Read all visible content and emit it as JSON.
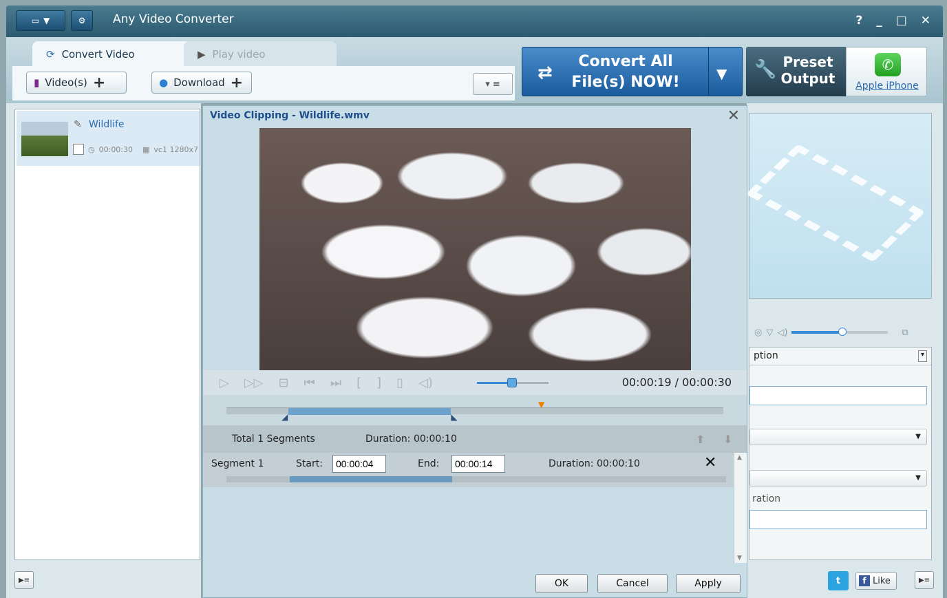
{
  "app": {
    "title": "Any Video Converter"
  },
  "window_controls": {
    "help": "?",
    "minimize": "_",
    "maximize": "□",
    "close": "✕"
  },
  "tabs": [
    {
      "label": "Convert Video",
      "active": true
    },
    {
      "label": "Play video",
      "active": false
    }
  ],
  "toolbar": {
    "videos_label": "Video(s)",
    "download_label": "Download",
    "convert_label": "Convert All File(s) NOW!",
    "preset_label": "Preset Output",
    "preset_device": "Apple iPhone"
  },
  "file_list": {
    "items": [
      {
        "name": "Wildlife",
        "duration": "00:00:30",
        "codec": "vc1 1280x7"
      }
    ]
  },
  "dialog": {
    "title": "Video Clipping - Wildlife.wmv",
    "time_display": "00:00:19 / 00:00:30",
    "progress_fraction": 0.633,
    "total_segments": "Total 1 Segments",
    "total_duration": "Duration: 00:00:10",
    "segment": {
      "name": "Segment 1",
      "start_label": "Start:",
      "start_value": "00:00:04",
      "end_label": "End:",
      "end_value": "00:00:14",
      "duration": "Duration: 00:00:10",
      "start_fraction": 0.133,
      "end_fraction": 0.467
    },
    "buttons": {
      "ok": "OK",
      "cancel": "Cancel",
      "apply": "Apply"
    }
  },
  "right_panel": {
    "option_header": "ption",
    "field_label": "ration"
  },
  "social": {
    "twitter": "t",
    "facebook_like": "Like"
  },
  "colors": {
    "accent": "#1a5b9c",
    "selection": "#dbeaf4",
    "link": "#2b6cb0"
  }
}
